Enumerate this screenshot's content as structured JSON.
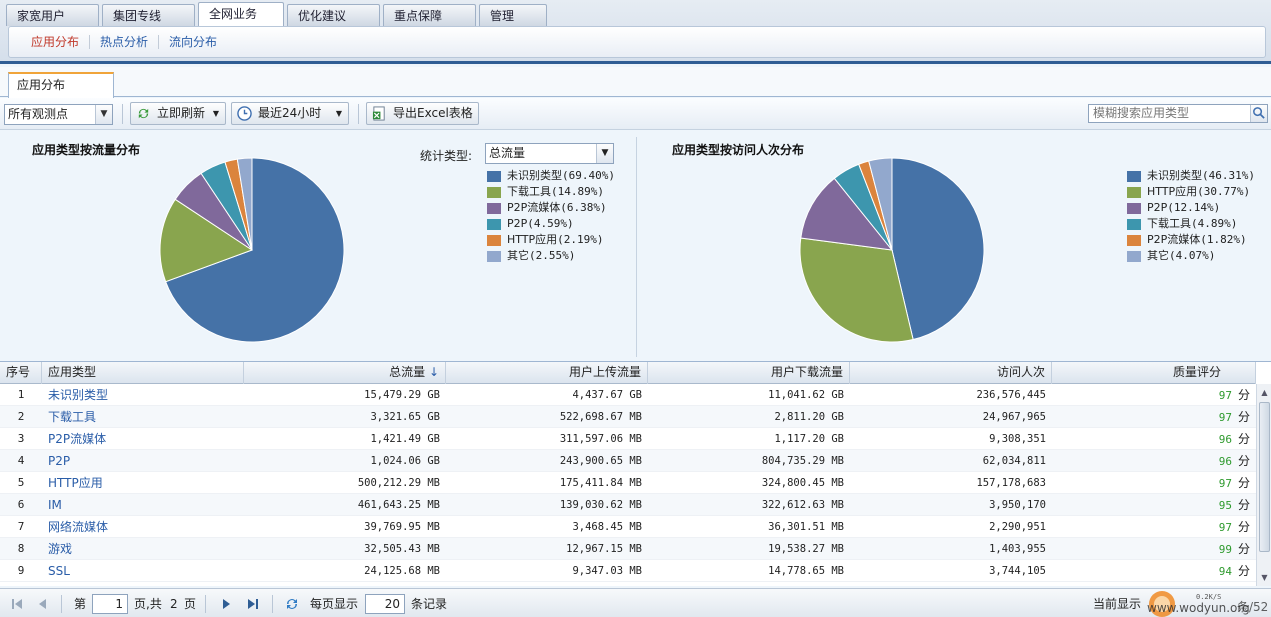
{
  "nav": {
    "main_tabs": [
      "家宽用户",
      "集团专线",
      "全网业务",
      "优化建议",
      "重点保障",
      "管理"
    ],
    "active_main_tab": "全网业务",
    "sub_tabs": [
      "应用分布",
      "热点分析",
      "流向分布"
    ],
    "active_sub_tab": "应用分布"
  },
  "page_tab": "应用分布",
  "toolbar": {
    "probe_select": "所有观测点",
    "refresh_label": "立即刷新",
    "time_select": "最近24小时",
    "export_label": "导出Excel表格",
    "search_placeholder": "模糊搜索应用类型",
    "icons": [
      "refresh-icon",
      "clock-icon",
      "excel-icon",
      "search-icon"
    ]
  },
  "chart_data": [
    {
      "type": "pie",
      "title": "应用类型按流量分布",
      "stat_label": "统计类型:",
      "stat_select": "总流量",
      "legend_position": "right",
      "series": [
        {
          "name": "未识别类型",
          "pct": "69.40%",
          "value": 69.4,
          "color": "#4572a7"
        },
        {
          "name": "下载工具",
          "pct": "14.89%",
          "value": 14.89,
          "color": "#89a54e"
        },
        {
          "name": "P2P流媒体",
          "pct": "6.38%",
          "value": 6.38,
          "color": "#80699b"
        },
        {
          "name": "P2P",
          "pct": "4.59%",
          "value": 4.59,
          "color": "#3d96ae"
        },
        {
          "name": "HTTP应用",
          "pct": "2.19%",
          "value": 2.19,
          "color": "#db843d"
        },
        {
          "name": "其它",
          "pct": "2.55%",
          "value": 2.55,
          "color": "#92a8cd"
        }
      ]
    },
    {
      "type": "pie",
      "title": "应用类型按访问人次分布",
      "legend_position": "right",
      "series": [
        {
          "name": "未识别类型",
          "pct": "46.31%",
          "value": 46.31,
          "color": "#4572a7"
        },
        {
          "name": "HTTP应用",
          "pct": "30.77%",
          "value": 30.77,
          "color": "#89a54e"
        },
        {
          "name": "P2P",
          "pct": "12.14%",
          "value": 12.14,
          "color": "#80699b"
        },
        {
          "name": "下载工具",
          "pct": "4.89%",
          "value": 4.89,
          "color": "#3d96ae"
        },
        {
          "name": "P2P流媒体",
          "pct": "1.82%",
          "value": 1.82,
          "color": "#db843d"
        },
        {
          "name": "其它",
          "pct": "4.07%",
          "value": 4.07,
          "color": "#92a8cd"
        }
      ]
    }
  ],
  "table": {
    "columns": [
      "序号",
      "应用类型",
      "总流量",
      "用户上传流量",
      "用户下载流量",
      "访问人次",
      "质量评分"
    ],
    "sort_indicator": "↓",
    "score_unit": "分",
    "rows": [
      [
        "1",
        "未识别类型",
        "15,479.29 GB",
        "4,437.67 GB",
        "11,041.62 GB",
        "236,576,445",
        "97"
      ],
      [
        "2",
        "下载工具",
        "3,321.65 GB",
        "522,698.67 MB",
        "2,811.20 GB",
        "24,967,965",
        "97"
      ],
      [
        "3",
        "P2P流媒体",
        "1,421.49 GB",
        "311,597.06 MB",
        "1,117.20 GB",
        "9,308,351",
        "96"
      ],
      [
        "4",
        "P2P",
        "1,024.06 GB",
        "243,900.65 MB",
        "804,735.29 MB",
        "62,034,811",
        "96"
      ],
      [
        "5",
        "HTTP应用",
        "500,212.29 MB",
        "175,411.84 MB",
        "324,800.45 MB",
        "157,178,683",
        "97"
      ],
      [
        "6",
        "IM",
        "461,643.25 MB",
        "139,030.62 MB",
        "322,612.63 MB",
        "3,950,170",
        "95"
      ],
      [
        "7",
        "网络流媒体",
        "39,769.95 MB",
        "3,468.45 MB",
        "36,301.51 MB",
        "2,290,951",
        "97"
      ],
      [
        "8",
        "游戏",
        "32,505.43 MB",
        "12,967.15 MB",
        "19,538.27 MB",
        "1,403,955",
        "99"
      ],
      [
        "9",
        "SSL",
        "24,125.68 MB",
        "9,347.03 MB",
        "14,778.65 MB",
        "3,744,105",
        "94"
      ]
    ]
  },
  "pager": {
    "page_prefix": "第",
    "current_page": "1",
    "page_mid": "页,共",
    "total_pages": "2",
    "page_suffix": "页",
    "per_page_label": "每页显示",
    "per_page": "20",
    "per_page_suffix": "条记录",
    "status_left": "当前显示",
    "status_right": "条/52"
  },
  "watermark": {
    "text": "www.wodyun.org",
    "speed": "0.2K/S"
  }
}
